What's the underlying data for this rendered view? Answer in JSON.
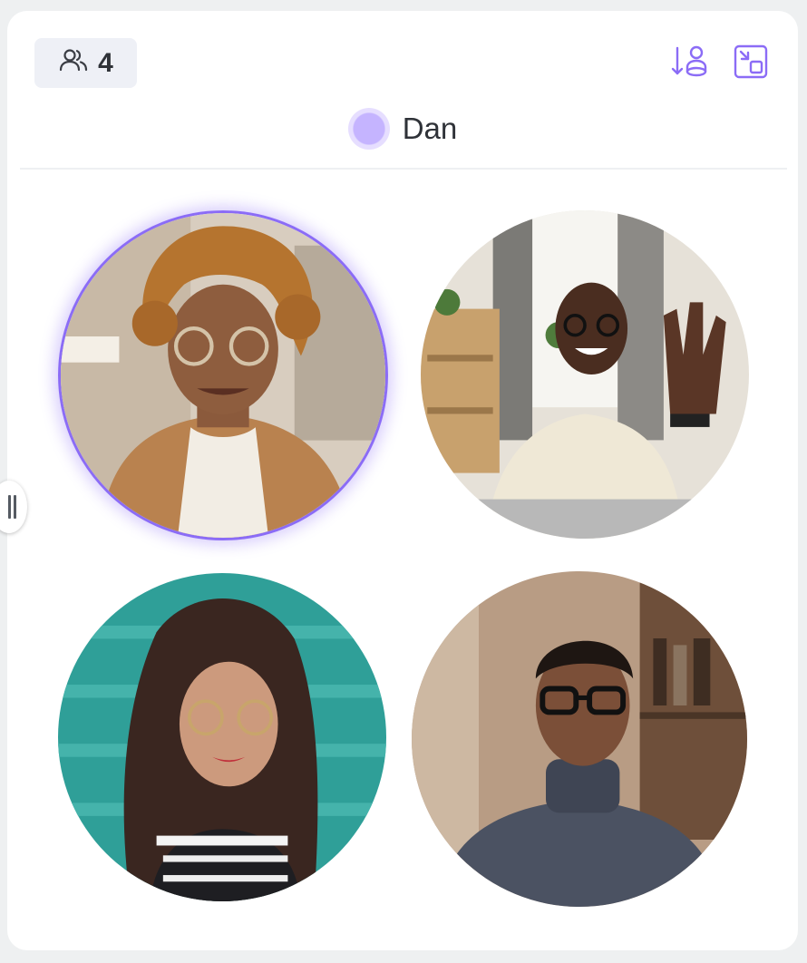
{
  "header": {
    "participants_icon": "people-icon",
    "participant_count": "4",
    "sort_icon": "sort-participants-icon",
    "layout_icon": "picture-in-picture-icon"
  },
  "active_speaker": {
    "name": "Dan",
    "indicator_color": "#c5b4ff"
  },
  "participants": [
    {
      "tile": "video-tile-1",
      "speaking": true,
      "highlight_color": "#8b6cf6"
    },
    {
      "tile": "video-tile-2",
      "speaking": false
    },
    {
      "tile": "video-tile-3",
      "speaking": false
    },
    {
      "tile": "video-tile-4",
      "speaking": false
    }
  ],
  "colors": {
    "accent": "#8b6cf6",
    "background": "#eef0f1",
    "panel": "#ffffff",
    "badge": "#eef0f6",
    "text": "#2f3238"
  },
  "side_handle": {
    "icon": "resize-handle-icon"
  }
}
